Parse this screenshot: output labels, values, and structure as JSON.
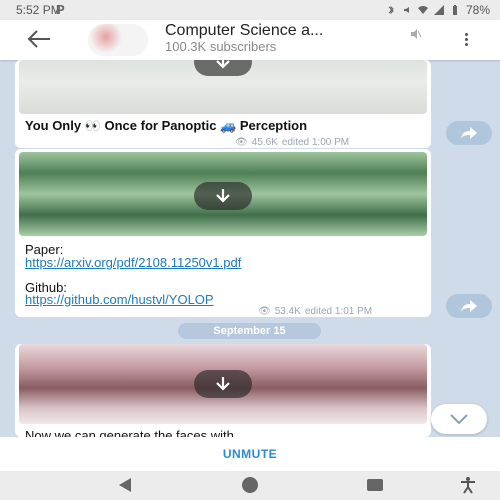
{
  "status_bar": {
    "time": "5:52 PM",
    "app_icon": "P",
    "battery": "78%"
  },
  "header": {
    "title": "Computer Science a...",
    "subscribers": "100.3K subscribers"
  },
  "messages": [
    {
      "title": "You Only 👀 Once for Panoptic 🚙 Perception",
      "views": "45.6K",
      "edited": "edited 1:00 PM"
    },
    {
      "paper_label": "Paper:",
      "paper_link": "https://arxiv.org/pdf/2108.11250v1.pdf",
      "github_label": "Github:",
      "github_link": "https://github.com/hustvl/YOLOP",
      "views": "53.4K",
      "edited": "edited 1:01 PM"
    },
    {
      "text": "Now we can generate the faces with"
    }
  ],
  "date_separator": "September 15",
  "unmute_label": "UNMUTE",
  "colors": {
    "accent": "#2a8bd2",
    "link": "#1d7bbf",
    "chat_background": "#cfdbe8"
  },
  "icons": {
    "back": "arrow-left-icon",
    "mute": "mute-icon",
    "menu": "more-vertical-icon",
    "download": "download-icon",
    "share": "share-icon",
    "views": "eye-icon",
    "scroll": "chevron-down-icon"
  }
}
